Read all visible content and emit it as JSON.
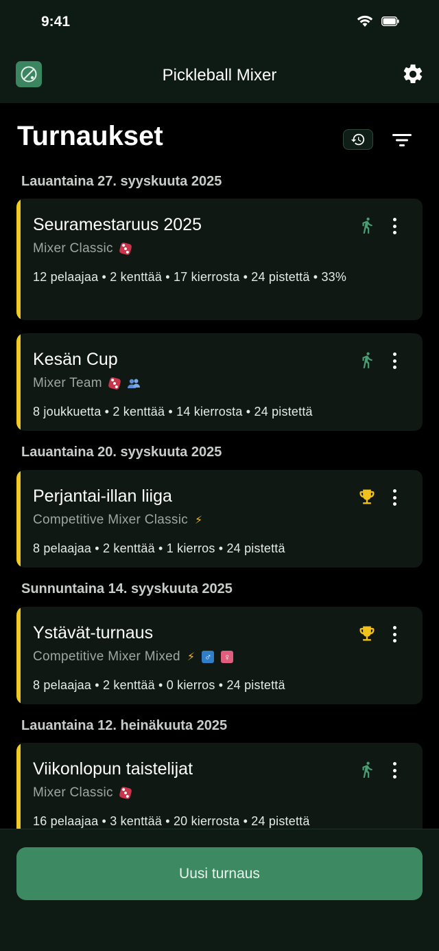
{
  "status_bar": {
    "time": "9:41"
  },
  "header": {
    "app_title": "Pickleball Mixer"
  },
  "page": {
    "title": "Turnaukset"
  },
  "groups": [
    {
      "date": "Lauantaina 27. syyskuuta 2025"
    },
    {
      "date": "Lauantaina 20. syyskuuta 2025"
    },
    {
      "date": "Sunnuntaina 14. syyskuuta 2025"
    },
    {
      "date": "Lauantaina 12. heinäkuuta 2025"
    }
  ],
  "tournaments": [
    {
      "name": "Seuramestaruus 2025",
      "type": "Mixer Classic",
      "meta": "12 pelaajaa  •  2 kenttää  •  17 kierrosta  •  24 pistettä  •  33%",
      "status": "running-icon",
      "accent": "#f1cb25"
    },
    {
      "name": "Kesän Cup",
      "type": "Mixer Team",
      "meta": "8 joukkuetta  •  2 kenttää  •  14 kierrosta  •  24 pistettä",
      "status": "running-icon",
      "accent": "#f1cb25"
    },
    {
      "name": "Perjantai-illan liiga",
      "type": "Competitive Mixer Classic",
      "meta": "8 pelaajaa  •  2 kenttää  •  1 kierros  •  24 pistettä",
      "status": "trophy-icon",
      "accent": "#f1cb25"
    },
    {
      "name": "Ystävät-turnaus",
      "type": "Competitive Mixer Mixed",
      "meta": "8 pelaajaa  •  2 kenttää  •  0 kierros  •  24 pistettä",
      "status": "trophy-icon",
      "accent": "#f1cb25"
    },
    {
      "name": "Viikonlopun taistelijat",
      "type": "Mixer Classic",
      "meta": "16 pelaajaa  •  3 kenttää  •  20 kierrosta  •  24 pistettä",
      "status": "running-icon",
      "accent": "#f1cb25"
    }
  ],
  "actions": {
    "new_tournament": "Uusi turnaus"
  },
  "colors": {
    "accent": "#3d8a62",
    "highlight": "#f1cb25",
    "background": "#000000",
    "card": "#0f1813"
  }
}
